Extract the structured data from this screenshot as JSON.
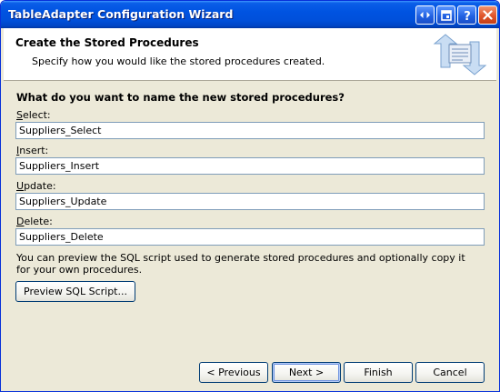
{
  "window": {
    "title": "TableAdapter Configuration Wizard"
  },
  "header": {
    "title": "Create the Stored Procedures",
    "subtitle": "Specify how you would like the stored procedures created."
  },
  "form": {
    "question": "What do you want to name the new stored procedures?",
    "fields": [
      {
        "label": "Select:",
        "value": "Suppliers_Select"
      },
      {
        "label": "Insert:",
        "value": "Suppliers_Insert"
      },
      {
        "label": "Update:",
        "value": "Suppliers_Update"
      },
      {
        "label": "Delete:",
        "value": "Suppliers_Delete"
      }
    ],
    "info": "You can preview the SQL script used to generate stored procedures and optionally copy it for your own procedures.",
    "preview_label": "Preview SQL Script..."
  },
  "footer": {
    "previous_label": "< Previous",
    "next_label": "Next >",
    "finish_label": "Finish",
    "cancel_label": "Cancel"
  },
  "icons": {
    "titlebar": [
      "help-move-icon",
      "restore-icon",
      "help-icon",
      "close-icon"
    ],
    "header": "database-arrows-icon"
  },
  "colors": {
    "titlebar": "#0053e1",
    "dialog_bg": "#ece9d8",
    "input_border": "#7f9db9"
  }
}
